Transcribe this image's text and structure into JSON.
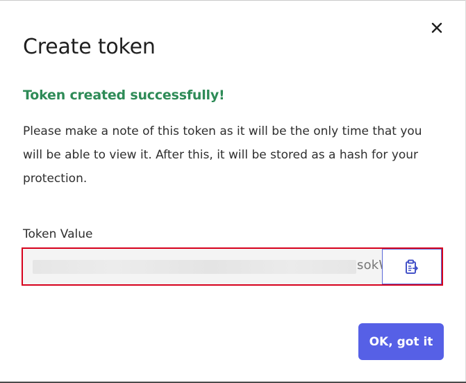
{
  "dialog": {
    "title": "Create token",
    "success_message": "Token created successfully!",
    "note": "Please make a note of this token as it will be the only time that you will be able to view it. After this, it will be stored as a hash for your protection.",
    "token_label": "Token Value",
    "token_visible_suffix": "sokW",
    "ok_button": "OK, got it"
  },
  "icons": {
    "close": "close-icon",
    "copy": "clipboard-copy-icon"
  },
  "colors": {
    "success": "#2e8b57",
    "primary": "#5660e6",
    "highlight": "#d6001c"
  }
}
